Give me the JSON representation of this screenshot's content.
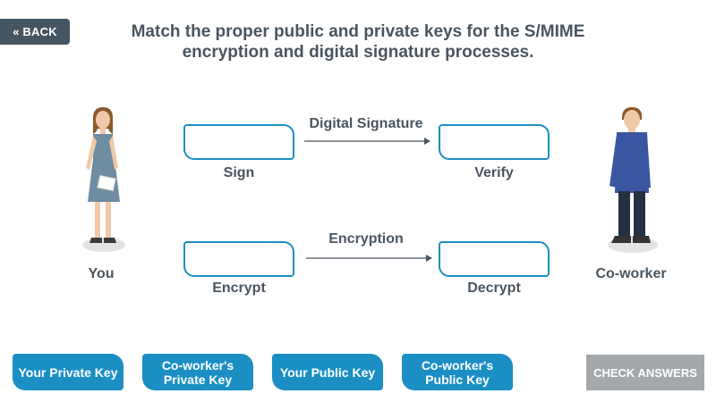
{
  "nav": {
    "back_label": "« BACK"
  },
  "instructions": {
    "line1": "Match the proper public and private keys for the S/MIME",
    "line2": "encryption and digital signature processes."
  },
  "people": {
    "left": "You",
    "right": "Co-worker"
  },
  "rows": [
    {
      "flow_label": "Digital Signature",
      "from_label": "Sign",
      "to_label": "Verify"
    },
    {
      "flow_label": "Encryption",
      "from_label": "Encrypt",
      "to_label": "Decrypt"
    }
  ],
  "keys": [
    {
      "label": "Your Private Key"
    },
    {
      "label": "Co-worker's\nPrivate Key"
    },
    {
      "label": "Your Public Key"
    },
    {
      "label": "Co-worker's\nPublic Key"
    }
  ],
  "actions": {
    "check_label": "CHECK ANSWERS"
  },
  "colors": {
    "accent": "#1b8fc4",
    "back_bg": "#465562",
    "check_bg": "#a3a8ab"
  }
}
